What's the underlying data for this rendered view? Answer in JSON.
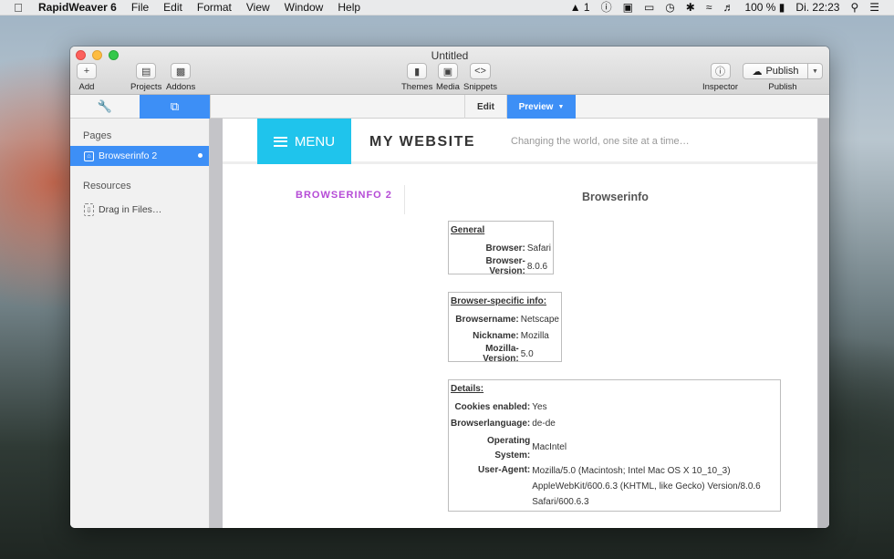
{
  "menubar": {
    "apple": "",
    "app": "RapidWeaver 6",
    "items": [
      "File",
      "Edit",
      "Format",
      "View",
      "Window",
      "Help"
    ],
    "adobe": "1",
    "battery": "100 %",
    "clock": "Di. 22:23"
  },
  "window": {
    "title": "Untitled",
    "toolbar": {
      "add": "Add",
      "projects": "Projects",
      "addons": "Addons",
      "themes": "Themes",
      "media": "Media",
      "snippets": "Snippets",
      "inspector": "Inspector",
      "publish_button": "Publish",
      "publish_label": "Publish"
    },
    "tabs": {
      "edit": "Edit",
      "preview": "Preview"
    }
  },
  "sidebar": {
    "pages_heading": "Pages",
    "page_item": "Browserinfo 2",
    "resources_heading": "Resources",
    "drag_files": "Drag in Files…"
  },
  "site": {
    "menu_label": "MENU",
    "title": "MY WEBSITE",
    "slogan": "Changing the world, one site at a time…",
    "nav_title": "BROWSERINFO 2",
    "heading": "Browserinfo",
    "general": {
      "title": "General",
      "rows": [
        {
          "k": "Browser:",
          "v": "Safari"
        },
        {
          "k": "Browser-Version:",
          "v": "8.0.6"
        }
      ]
    },
    "specific": {
      "title": "Browser-specific info:",
      "rows": [
        {
          "k": "Browsername:",
          "v": "Netscape"
        },
        {
          "k": "Nickname:",
          "v": "Mozilla"
        },
        {
          "k": "Mozilla-Version:",
          "v": "5.0"
        }
      ]
    },
    "details": {
      "title": "Details:",
      "cookies_k": "Cookies enabled:",
      "cookies_v": "Yes",
      "lang_k": "Browserlanguage:",
      "lang_v": "de-de",
      "os_k1": "Operating",
      "os_k2": "System:",
      "os_v": "MacIntel",
      "ua_k": "User-Agent:",
      "ua_v1": "Mozilla/5.0 (Macintosh; Intel Mac OS X 10_10_3)",
      "ua_v2": "AppleWebKit/600.6.3 (KHTML, like Gecko) Version/8.0.6",
      "ua_v3": "Safari/600.6.3"
    }
  }
}
